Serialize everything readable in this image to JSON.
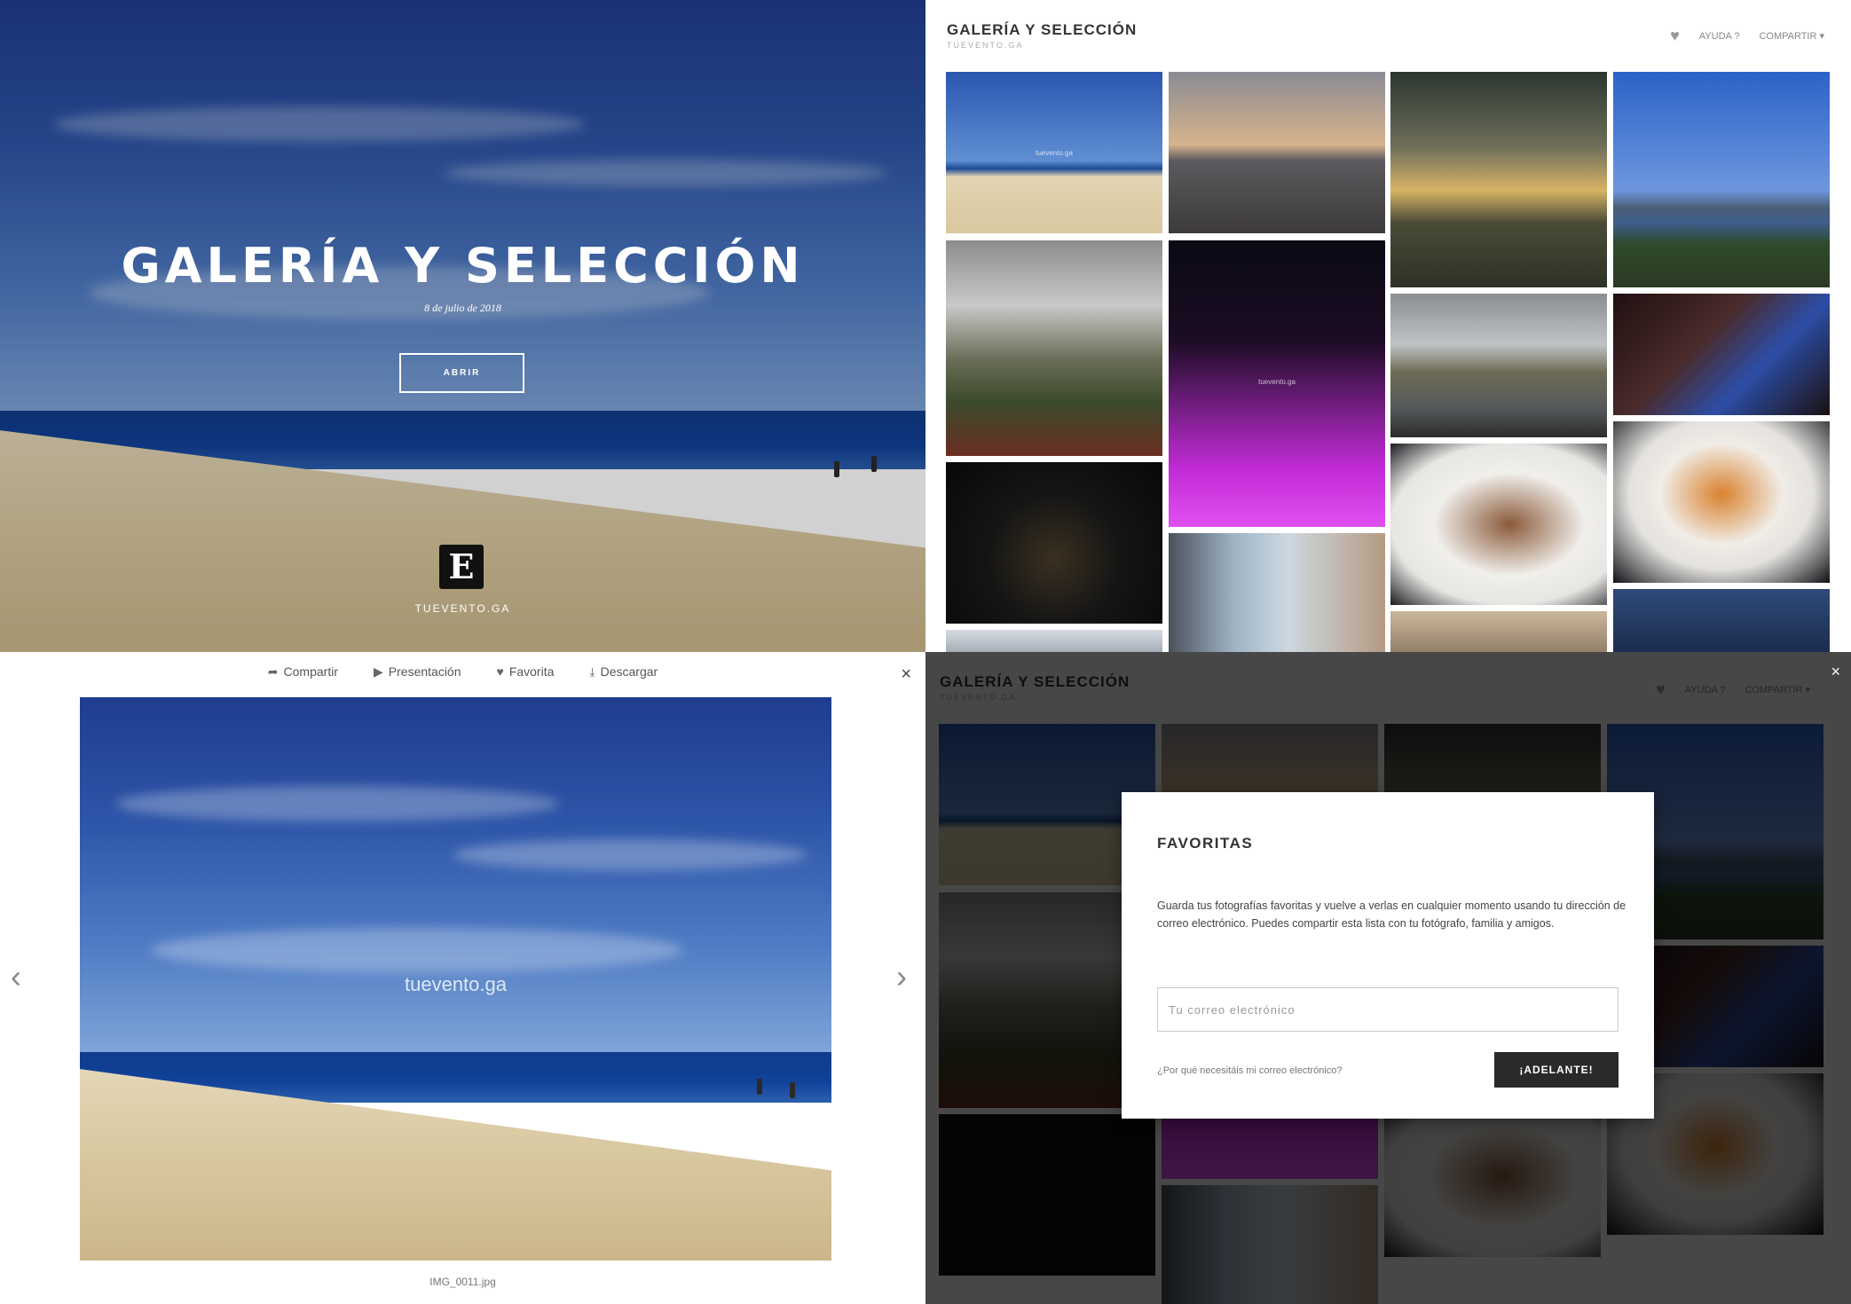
{
  "hero": {
    "title": "GALERÍA Y SELECCIÓN",
    "date": "8 de julio de 2018",
    "open_button": "ABRIR",
    "logo_glyph": "E",
    "brand": "TUEVENTO.GA"
  },
  "gallery": {
    "title": "GALERÍA Y SELECCIÓN",
    "subtitle": "TUEVENTO.GA",
    "nav": {
      "heart_icon": "heart-icon",
      "help": "AYUDA ?",
      "share": "COMPARTIR ▾"
    },
    "watermark": "tuevento.ga"
  },
  "lightbox": {
    "actions": {
      "share": "Compartir",
      "slideshow": "Presentación",
      "favorite": "Favorita",
      "download": "Descargar"
    },
    "close": "×",
    "prev": "‹",
    "next": "›",
    "watermark": "tuevento.ga",
    "filename": "IMG_0011.jpg"
  },
  "favorites_modal": {
    "title": "FAVORITAS",
    "text": "Guarda tus fotografías favoritas y vuelve a verlas en cualquier momento usando tu dirección de correo electrónico. Puedes compartir esta lista con tu fotógrafo, familia y amigos.",
    "email_placeholder": "Tu correo electrónico",
    "why_link": "¿Por qué necesitáis mi correo electrónico?",
    "go_button": "¡ADELANTE!",
    "close": "×"
  },
  "colors": {
    "accent_dark": "#2a2a2a",
    "sky": "#2d55a8",
    "purple_light": "#c22bd6"
  }
}
